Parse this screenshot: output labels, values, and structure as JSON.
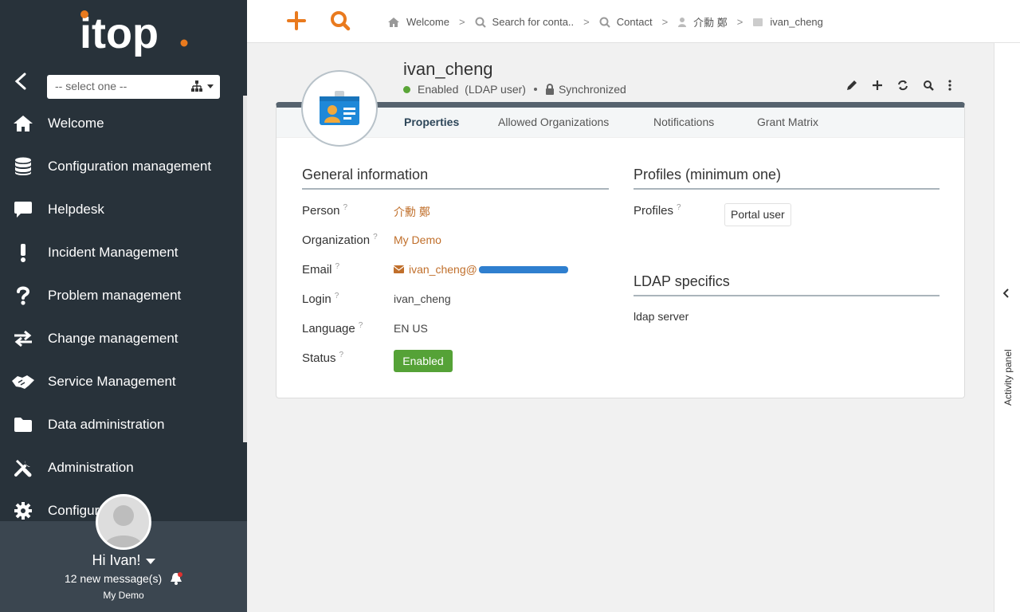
{
  "sidebar": {
    "logo_text": "itop",
    "org_select": {
      "placeholder": "-- select one --"
    },
    "menu": [
      {
        "label": "Welcome",
        "icon": "home-icon"
      },
      {
        "label": "Configuration management",
        "icon": "database-icon"
      },
      {
        "label": "Helpdesk",
        "icon": "chat-icon"
      },
      {
        "label": "Incident Management",
        "icon": "exclamation-icon"
      },
      {
        "label": "Problem management",
        "icon": "question-icon"
      },
      {
        "label": "Change management",
        "icon": "exchange-icon"
      },
      {
        "label": "Service Management",
        "icon": "handshake-icon"
      },
      {
        "label": "Data administration",
        "icon": "folder-icon"
      },
      {
        "label": "Administration",
        "icon": "tools-icon"
      },
      {
        "label": "Configur",
        "icon": "gear-icon"
      }
    ],
    "user": {
      "greeting": "Hi Ivan!",
      "messages": "12 new message(s)",
      "organization": "My Demo"
    }
  },
  "breadcrumbs": [
    {
      "label": "Welcome",
      "icon": "home-icon"
    },
    {
      "label": "Search for conta..",
      "icon": "search-icon"
    },
    {
      "label": "Contact",
      "icon": "search-icon"
    },
    {
      "label": "介勳 鄭",
      "icon": "person-icon"
    },
    {
      "label": "ivan_cheng",
      "icon": "id-card-icon"
    }
  ],
  "object": {
    "title": "ivan_cheng",
    "status": "Enabled",
    "status_detail": "(LDAP user)",
    "sync": "Synchronized",
    "actions": [
      "edit-icon",
      "plus-icon",
      "refresh-icon",
      "search-icon",
      "more-icon"
    ],
    "tabs": [
      "Properties",
      "Allowed Organizations",
      "Notifications",
      "Grant Matrix"
    ],
    "active_tab": "Properties"
  },
  "general": {
    "title": "General information",
    "help_mark": "?",
    "person_label": "Person",
    "person_value": "介勳 鄭",
    "organization_label": "Organization",
    "organization_value": "My Demo",
    "email_label": "Email",
    "email_value": "ivan_cheng@",
    "login_label": "Login",
    "login_value": "ivan_cheng",
    "language_label": "Language",
    "language_value": "EN US",
    "status_label": "Status",
    "status_value": "Enabled"
  },
  "profiles": {
    "title": "Profiles (minimum one)",
    "label": "Profiles",
    "items": [
      "Portal user"
    ]
  },
  "ldap": {
    "title": "LDAP specifics",
    "server_label": "ldap server"
  },
  "activity_panel": {
    "label": "Activity panel"
  },
  "colors": {
    "accent": "#e97a1e",
    "sidebar": "#28323a",
    "enabled": "#55a237",
    "link": "#c06f2b"
  }
}
